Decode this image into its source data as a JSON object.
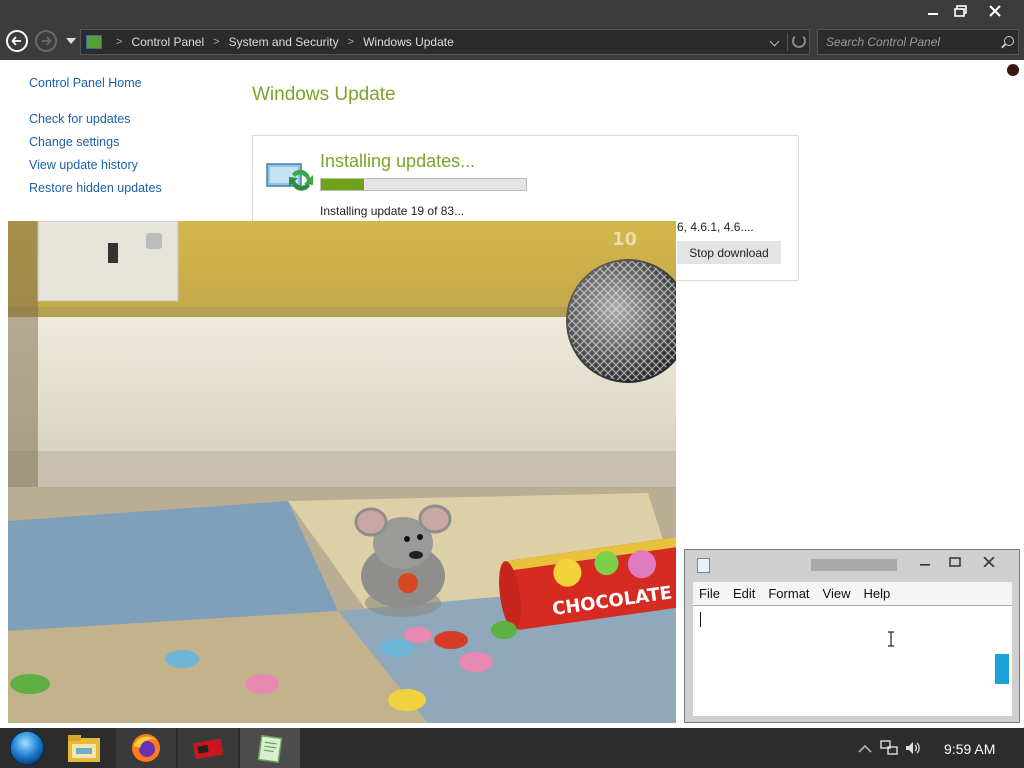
{
  "window": {
    "minimize_icon": "minimize-icon",
    "maximize_icon": "restore-icon",
    "close_icon": "close-icon"
  },
  "navbar": {
    "breadcrumbs": [
      "Control Panel",
      "System and Security",
      "Windows Update"
    ],
    "search_placeholder": "Search Control Panel"
  },
  "sidebar": {
    "home": "Control Panel Home",
    "links": [
      "Check for updates",
      "Change settings",
      "View update history",
      "Restore hidden updates"
    ]
  },
  "main": {
    "title": "Windows Update",
    "heading": "Installing updates...",
    "progress_fraction": 0.21,
    "status": "Installing update 19 of 83...",
    "detail_fragment": "6, 4.6.1, 4.6....",
    "stop_button": "Stop download",
    "accent_color": "#7ba428",
    "progress_color": "#6ea319"
  },
  "video": {
    "candy_can_label": "CHOCOLATE",
    "corner_mark": "10"
  },
  "notepad": {
    "menu": [
      "File",
      "Edit",
      "Format",
      "View",
      "Help"
    ],
    "scroll_accent": "#1aa3d9"
  },
  "taskbar": {
    "apps": [
      "start-orb-icon",
      "file-explorer-icon",
      "firefox-icon",
      "media-player-icon",
      "notepad-icon"
    ],
    "clock": "9:59 AM"
  }
}
